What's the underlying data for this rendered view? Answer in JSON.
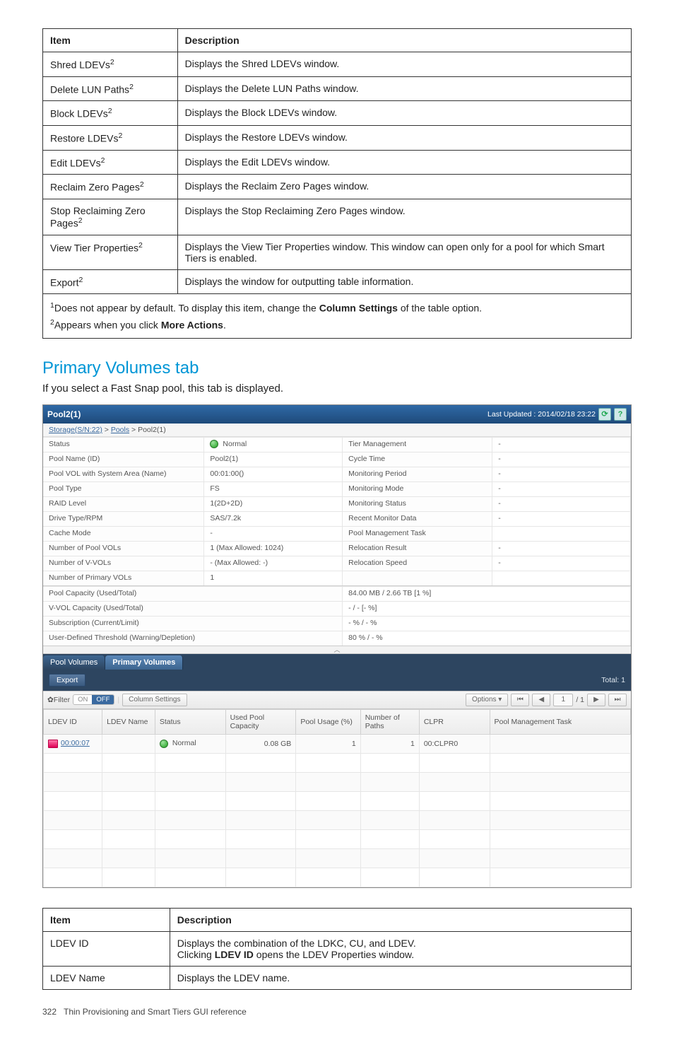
{
  "top_table": {
    "headers": [
      "Item",
      "Description"
    ],
    "rows": [
      {
        "item": "Shred LDEVs",
        "sup": "2",
        "desc": "Displays the Shred LDEVs window."
      },
      {
        "item": "Delete LUN Paths",
        "sup": "2",
        "desc": "Displays the Delete LUN Paths window."
      },
      {
        "item": "Block LDEVs",
        "sup": "2",
        "desc": "Displays the Block LDEVs window."
      },
      {
        "item": "Restore LDEVs",
        "sup": "2",
        "desc": "Displays the Restore LDEVs window."
      },
      {
        "item": "Edit LDEVs",
        "sup": "2",
        "desc": "Displays the Edit LDEVs window."
      },
      {
        "item": "Reclaim Zero Pages",
        "sup": "2",
        "desc": "Displays the Reclaim Zero Pages window."
      },
      {
        "item": "Stop Reclaiming Zero Pages",
        "sup": "2",
        "desc": "Displays the Stop Reclaiming Zero Pages window."
      },
      {
        "item": "View Tier Properties",
        "sup": "2",
        "desc": "Displays the View Tier Properties window. This window can open only for a pool for which Smart Tiers is enabled."
      },
      {
        "item": "Export",
        "sup": "2",
        "desc": "Displays the window for outputting table information."
      }
    ]
  },
  "footnotes": {
    "fn1_pre": "Does not appear by default. To display this item, change the ",
    "fn1_bold": "Column Settings",
    "fn1_post": " of the table option.",
    "fn2_pre": "Appears when you click ",
    "fn2_bold": "More Actions",
    "fn2_post": "."
  },
  "section": {
    "heading": "Primary Volumes tab",
    "intro": "If you select a Fast Snap pool, this tab is displayed."
  },
  "app": {
    "title": "Pool2(1)",
    "last_updated": "Last Updated : 2014/02/18 23:22",
    "breadcrumb": {
      "root": "Storage(S/N:22)",
      "mid": "Pools",
      "leaf": "Pool2(1)"
    },
    "info_left": [
      [
        "Status",
        "● Normal"
      ],
      [
        "Pool Name (ID)",
        "Pool2(1)"
      ],
      [
        "Pool VOL with System Area (Name)",
        "00:01:00()"
      ],
      [
        "Pool Type",
        "FS"
      ],
      [
        "RAID Level",
        "1(2D+2D)"
      ],
      [
        "Drive Type/RPM",
        "SAS/7.2k"
      ],
      [
        "Cache Mode",
        "-"
      ],
      [
        "Number of Pool VOLs",
        "1 (Max Allowed: 1024)"
      ],
      [
        "Number of V-VOLs",
        "- (Max Allowed: -)"
      ],
      [
        "Number of Primary VOLs",
        "1"
      ]
    ],
    "info_right": [
      [
        "Tier Management",
        "-"
      ],
      [
        "Cycle Time",
        "-"
      ],
      [
        "Monitoring Period",
        "-"
      ],
      [
        "Monitoring Mode",
        "-"
      ],
      [
        "Monitoring Status",
        "-"
      ],
      [
        "Recent Monitor Data",
        "-"
      ],
      [
        "Pool Management Task",
        ""
      ],
      [
        "Relocation Result",
        "-"
      ],
      [
        "Relocation Speed",
        "-"
      ]
    ],
    "info_wide": [
      [
        "Pool Capacity (Used/Total)",
        "84.00 MB / 2.66 TB [1 %]"
      ],
      [
        "V-VOL Capacity (Used/Total)",
        "- / - [- %]"
      ],
      [
        "Subscription (Current/Limit)",
        "- % / - %"
      ],
      [
        "User-Defined Threshold (Warning/Depletion)",
        "80 % / - %"
      ]
    ],
    "tabs": {
      "pool": "Pool Volumes",
      "primary": "Primary Volumes"
    },
    "toolbar": {
      "export": "Export",
      "total_label": "Total:",
      "total_value": "1"
    },
    "filter_bar": {
      "filter_label": "✿Filter",
      "on": "ON",
      "off": "OFF",
      "col_settings": "Column Settings",
      "options": "Options ▾",
      "page": "1",
      "pages": "/ 1"
    },
    "grid": {
      "headers": [
        "LDEV ID",
        "LDEV Name",
        "Status",
        "Used Pool Capacity",
        "Pool Usage (%)",
        "Number of Paths",
        "CLPR",
        "Pool Management Task"
      ],
      "row": {
        "ldev_id": "00:00:07",
        "ldev_name": "",
        "status": "Normal",
        "used": "0.08 GB",
        "usage": "1",
        "paths": "1",
        "clpr": "00:CLPR0",
        "task": ""
      }
    }
  },
  "bottom_table": {
    "headers": [
      "Item",
      "Description"
    ],
    "rows": [
      {
        "item": "LDEV ID",
        "desc1": "Displays the combination of the LDKC, CU, and LDEV.",
        "desc2_pre": "Clicking ",
        "desc2_bold": "LDEV ID",
        "desc2_post": " opens the LDEV Properties window."
      },
      {
        "item": "LDEV Name",
        "desc": "Displays the LDEV name."
      }
    ]
  },
  "page_footer": {
    "num": "322",
    "text": "Thin Provisioning and Smart Tiers GUI reference"
  }
}
